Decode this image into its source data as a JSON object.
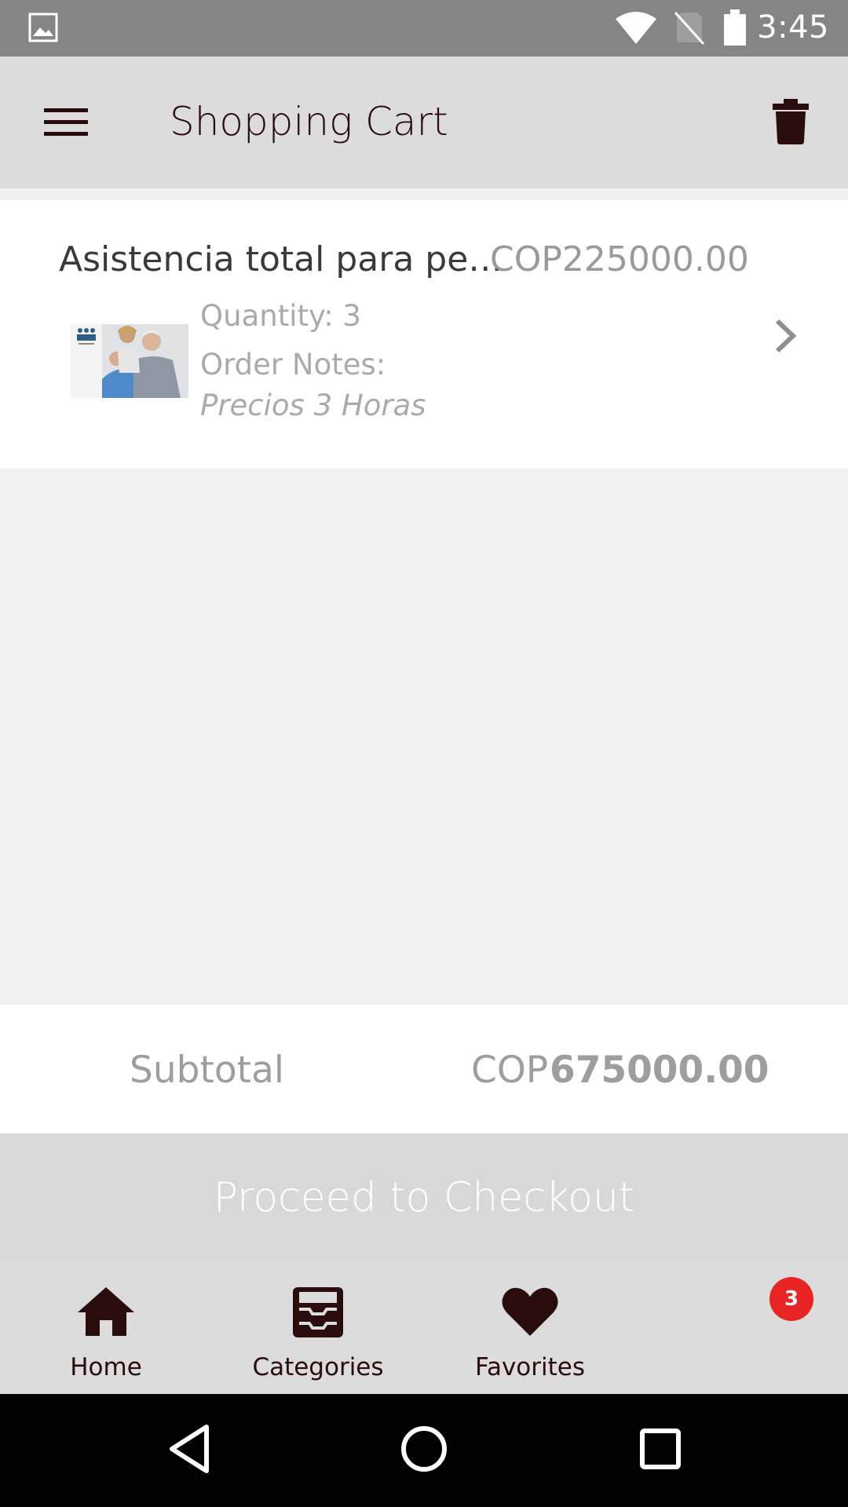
{
  "status_bar": {
    "time": "3:45",
    "icons": [
      "image-icon",
      "wifi-icon",
      "no-sim-icon",
      "battery-icon"
    ]
  },
  "app_bar": {
    "title": "Shopping Cart",
    "menu_icon": "hamburger-menu-icon",
    "delete_icon": "trash-icon"
  },
  "cart": {
    "items": [
      {
        "name": "Asistencia total para pe…",
        "price": "COP225000.00",
        "quantity_label": "Quantity: 3",
        "notes_label": "Order Notes:",
        "notes_text": "Precios 3 Horas",
        "thumbnail": "product-thumbnail"
      }
    ]
  },
  "subtotal": {
    "label": "Subtotal",
    "currency": "COP",
    "amount": "675000.00"
  },
  "checkout": {
    "label": "Proceed to Checkout"
  },
  "bottom_nav": {
    "items": [
      {
        "label": "Home",
        "icon": "home-icon"
      },
      {
        "label": "Categories",
        "icon": "categories-icon"
      },
      {
        "label": "Favorites",
        "icon": "heart-icon"
      }
    ],
    "badge": "3"
  },
  "colors": {
    "accent": "#2b0c0c",
    "badge": "#e82424",
    "app_bar": "#dcdcdc",
    "status_bar": "#858585"
  }
}
